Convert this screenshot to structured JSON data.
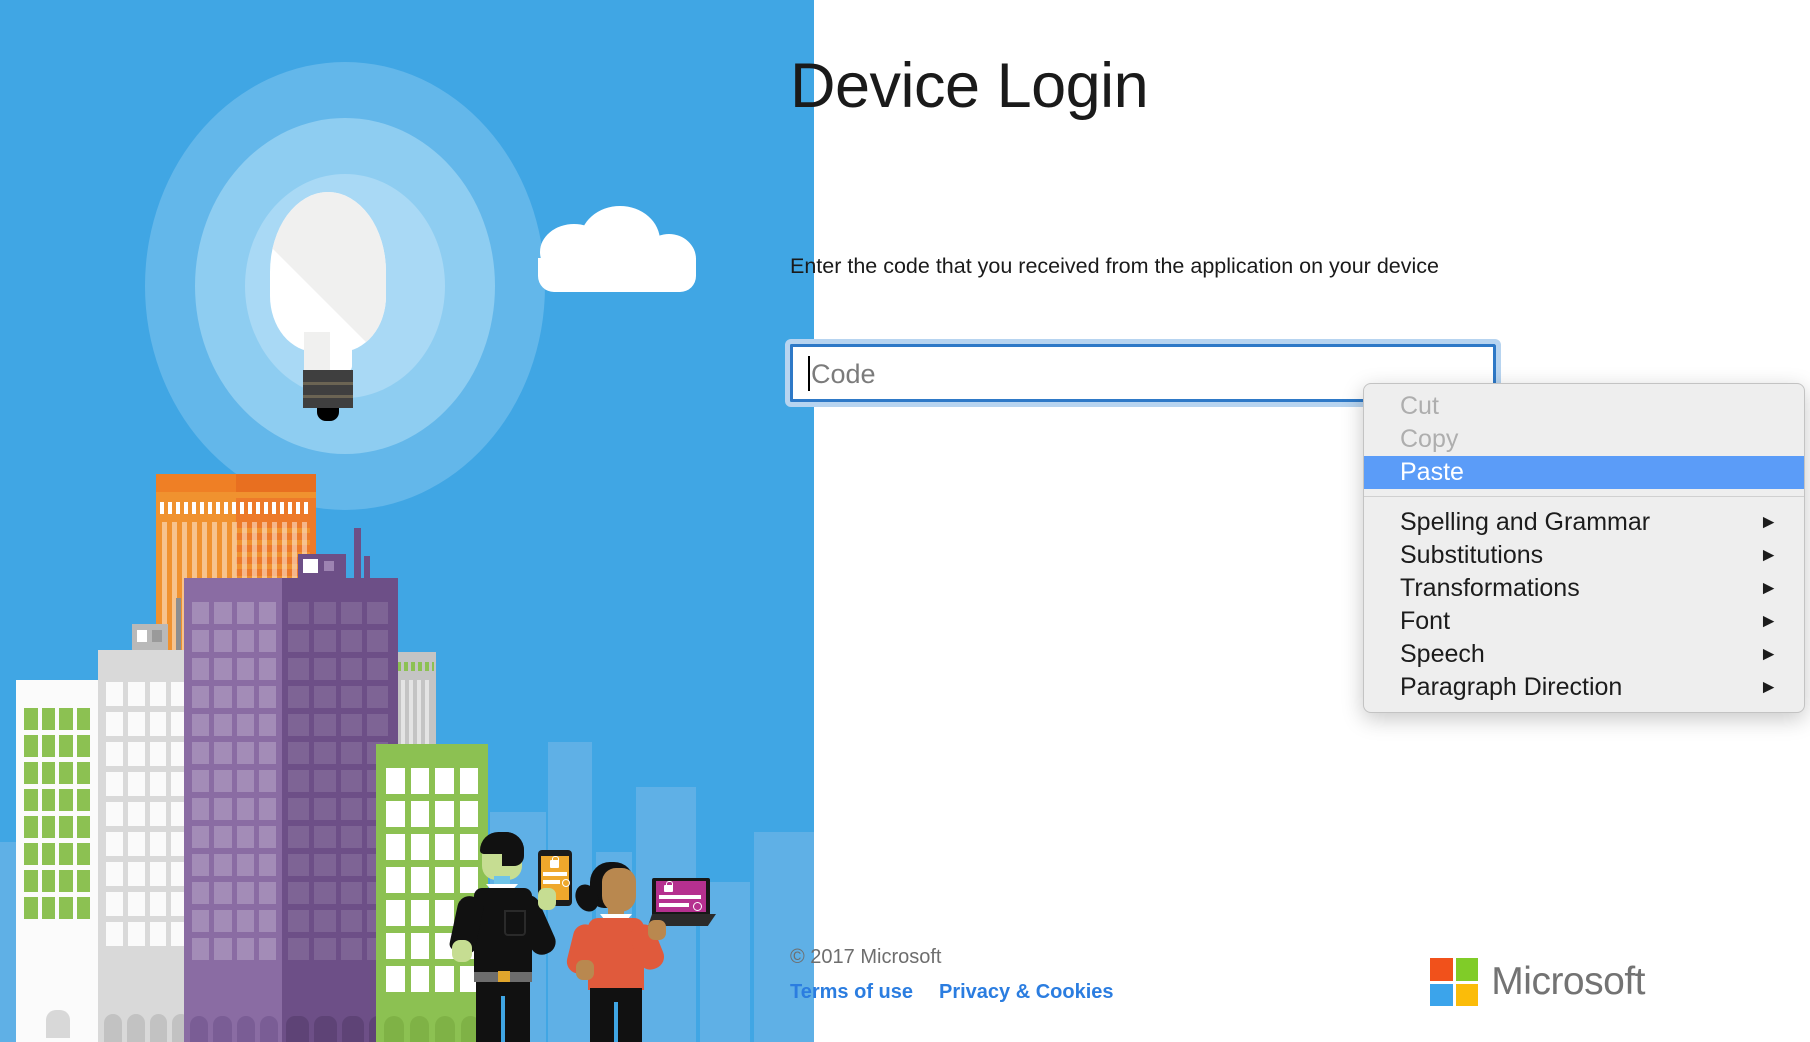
{
  "page": {
    "title": "Device Login"
  },
  "form": {
    "instruction": "Enter the code that you received from the application on your device",
    "code_placeholder": "Code",
    "code_value": ""
  },
  "footer": {
    "copyright": "© 2017 Microsoft",
    "links": [
      {
        "label": "Terms of use"
      },
      {
        "label": "Privacy & Cookies"
      }
    ],
    "brand": {
      "wordmark": "Microsoft",
      "logo_colors": {
        "top_left": "#f1511b",
        "top_right": "#80cc28",
        "bottom_left": "#3ba4eb",
        "bottom_right": "#fbbc09"
      }
    }
  },
  "context_menu": {
    "items": [
      {
        "label": "Cut",
        "state": "disabled",
        "has_submenu": false
      },
      {
        "label": "Copy",
        "state": "disabled",
        "has_submenu": false
      },
      {
        "label": "Paste",
        "state": "highlighted",
        "has_submenu": false
      },
      {
        "label": "Spelling and Grammar",
        "state": "normal",
        "has_submenu": true
      },
      {
        "label": "Substitutions",
        "state": "normal",
        "has_submenu": true
      },
      {
        "label": "Transformations",
        "state": "normal",
        "has_submenu": true
      },
      {
        "label": "Font",
        "state": "normal",
        "has_submenu": true
      },
      {
        "label": "Speech",
        "state": "normal",
        "has_submenu": true
      },
      {
        "label": "Paragraph Direction",
        "state": "normal",
        "has_submenu": true
      }
    ],
    "submenu_arrow": "►",
    "highlight_color": "#5b9cf8"
  },
  "illustration": {
    "background_color": "#40a6e4",
    "elements": [
      "lightbulb-icon",
      "cloud-icon",
      "cityscape",
      "person-with-tablet",
      "person-with-laptop"
    ]
  },
  "theme": {
    "accent_blue": "#2b7de0",
    "panel_blue": "#40a6e4",
    "input_border": "#2e79c7",
    "focus_ring": "#b7d4f0"
  }
}
